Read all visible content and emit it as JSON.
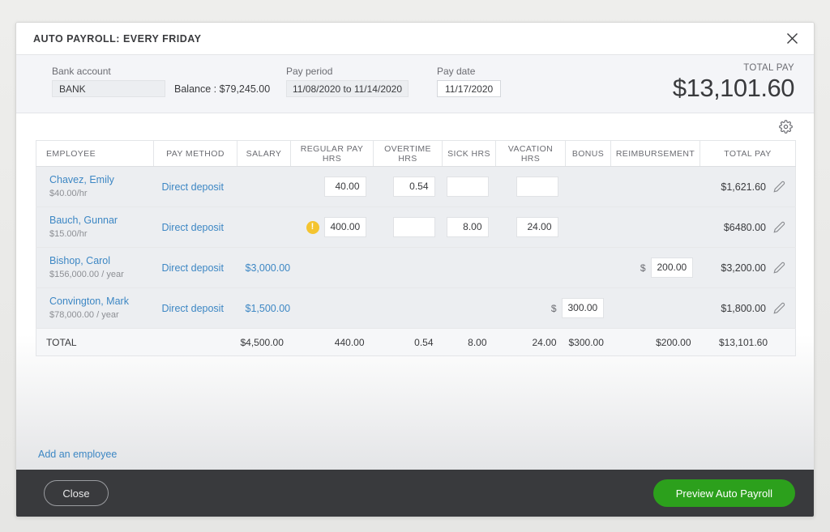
{
  "dialog": {
    "title": "AUTO PAYROLL: EVERY FRIDAY",
    "close_icon": "close-icon"
  },
  "summary": {
    "bank_account": {
      "label": "Bank account",
      "value": "BANK"
    },
    "balance": "Balance : $79,245.00",
    "pay_period": {
      "label": "Pay period",
      "value": "11/08/2020 to 11/14/2020"
    },
    "pay_date": {
      "label": "Pay date",
      "value": "11/17/2020"
    },
    "total_pay": {
      "label": "TOTAL PAY",
      "amount": "$13,101.60"
    },
    "gear_icon": "gear-icon"
  },
  "table": {
    "columns": [
      "EMPLOYEE",
      "PAY METHOD",
      "SALARY",
      "REGULAR PAY HRS",
      "OVERTIME HRS",
      "SICK HRS",
      "VACATION HRS",
      "BONUS",
      "REIMBURSEMENT",
      "TOTAL PAY"
    ],
    "rows": [
      {
        "name": "Chavez, Emily",
        "rate": "$40.00/hr",
        "pay_method": "Direct deposit",
        "salary": "",
        "regular_hrs": "40.00",
        "overtime_hrs": "0.54",
        "sick_hrs": "",
        "vacation_hrs": "",
        "bonus": "",
        "reimbursement": "",
        "total_pay": "$1,621.60",
        "warning": false
      },
      {
        "name": "Bauch, Gunnar",
        "rate": "$15.00/hr",
        "pay_method": "Direct deposit",
        "salary": "",
        "regular_hrs": "400.00",
        "overtime_hrs": "",
        "sick_hrs": "8.00",
        "vacation_hrs": "24.00",
        "bonus": "",
        "reimbursement": "",
        "total_pay": "$6480.00",
        "warning": true,
        "warning_glyph": "!"
      },
      {
        "name": "Bishop, Carol",
        "rate": "$156,000.00 / year",
        "pay_method": "Direct deposit",
        "salary": "$3,000.00",
        "regular_hrs": null,
        "overtime_hrs": null,
        "sick_hrs": null,
        "vacation_hrs": null,
        "bonus": null,
        "reimbursement": "200.00",
        "total_pay": "$3,200.00",
        "warning": false
      },
      {
        "name": "Convington, Mark",
        "rate": "$78,000.00 / year",
        "pay_method": "Direct deposit",
        "salary": "$1,500.00",
        "regular_hrs": null,
        "overtime_hrs": null,
        "sick_hrs": null,
        "vacation_hrs": null,
        "bonus": "300.00",
        "reimbursement": null,
        "total_pay": "$1,800.00",
        "warning": false
      }
    ],
    "totals": {
      "label": "TOTAL",
      "salary": "$4,500.00",
      "regular_hrs": "440.00",
      "overtime_hrs": "0.54",
      "sick_hrs": "8.00",
      "vacation_hrs": "24.00",
      "bonus": "$300.00",
      "reimbursement": "$200.00",
      "total_pay": "$13,101.60"
    },
    "currency_prefix": "$",
    "edit_icon": "pencil-icon"
  },
  "links": {
    "add_employee": "Add an employee"
  },
  "footer": {
    "close_label": "Close",
    "preview_label": "Preview Auto Payroll"
  },
  "colors": {
    "accent_link": "#3d87c4",
    "primary_button": "#2ca01c",
    "footer_bg": "#393a3d",
    "warning": "#f4c430"
  }
}
